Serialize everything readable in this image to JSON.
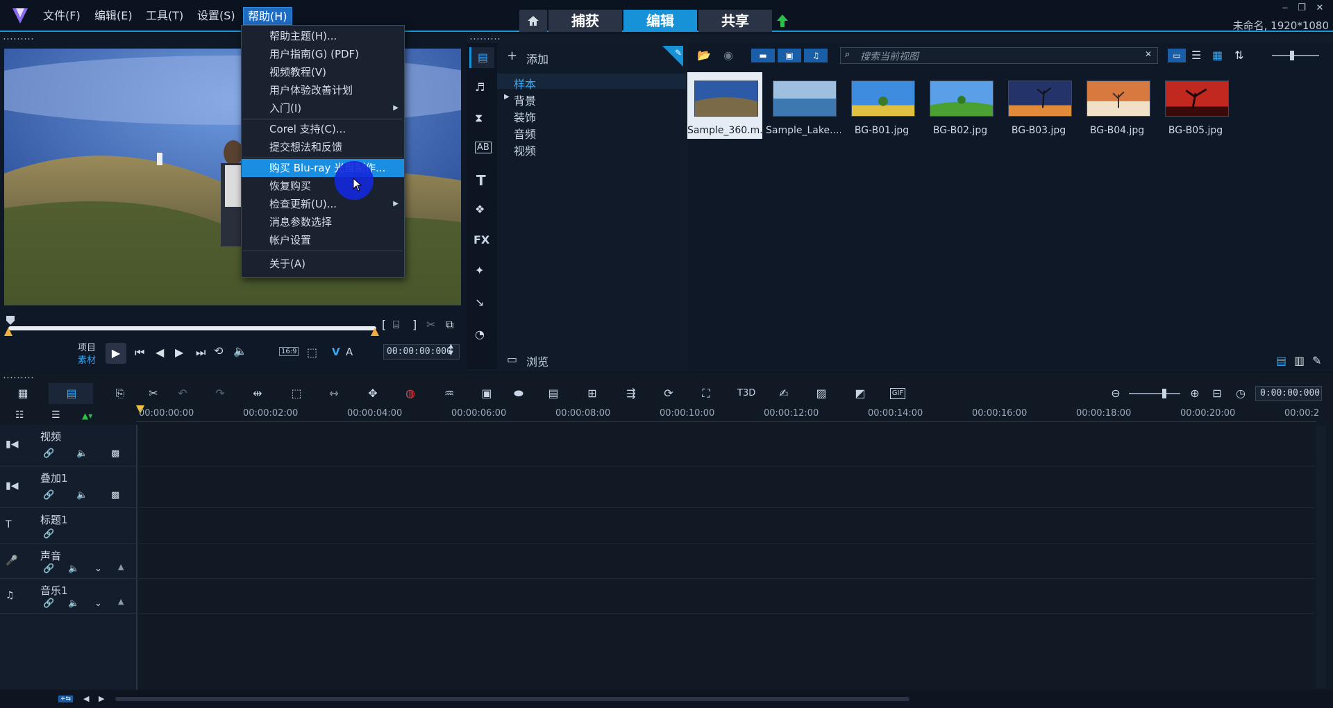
{
  "menu": {
    "file": "文件(F)",
    "edit": "编辑(E)",
    "tools": "工具(T)",
    "settings": "设置(S)",
    "help": "帮助(H)"
  },
  "tabs": {
    "capture": "捕获",
    "edit": "编辑",
    "share": "共享"
  },
  "project_info": "未命名, 1920*1080",
  "help_menu": {
    "items": [
      "帮助主题(H)...",
      "用户指南(G) (PDF)",
      "视频教程(V)",
      "用户体验改善计划",
      "入门(I)",
      "Corel 支持(C)...",
      "提交想法和反馈",
      "购买 Blu-ray 光盘制作...",
      "恢复购买",
      "检查更新(U)...",
      "消息参数选择",
      "帐户设置",
      "关于(A)"
    ]
  },
  "player": {
    "project_label": "项目",
    "clip_label": "素材",
    "aspect": "16:9",
    "timecode": "00:00:00:000"
  },
  "library": {
    "add_label": "添加",
    "search_placeholder": "搜索当前视图",
    "browse_label": "浏览",
    "tree": [
      "样本",
      "背景",
      "装饰",
      "音频",
      "视频"
    ],
    "thumbs": [
      "Sample_360.m...",
      "Sample_Lake....",
      "BG-B01.jpg",
      "BG-B02.jpg",
      "BG-B03.jpg",
      "BG-B04.jpg",
      "BG-B05.jpg"
    ]
  },
  "timeline": {
    "timecode": "0:00:00:000",
    "ruler": [
      "00:00:00:00",
      "00:00:02:00",
      "00:00:04:00",
      "00:00:06:00",
      "00:00:08:00",
      "00:00:10:00",
      "00:00:12:00",
      "00:00:14:00",
      "00:00:16:00",
      "00:00:18:00",
      "00:00:20:00",
      "00:00:2"
    ],
    "tracks": [
      "视频",
      "叠加1",
      "标题1",
      "声音",
      "音乐1"
    ]
  },
  "colors": {
    "accent": "#1792d8",
    "menu_highlight": "#1a8ee0",
    "bg": "#0f1724"
  }
}
